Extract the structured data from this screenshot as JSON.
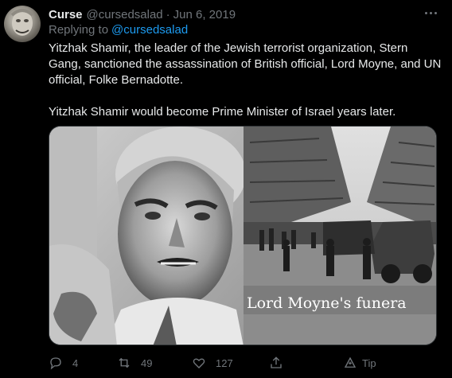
{
  "tweet": {
    "author_name": "Curse",
    "author_handle": "@cursedsalad",
    "separator": "·",
    "date": "Jun 6, 2019",
    "reply_prefix": "Replying to",
    "reply_mention": "@cursedsalad",
    "paragraphs": [
      "Yitzhak Shamir, the leader of the Jewish terrorist organization, Stern Gang, sanctioned the assassination of British official, Lord Moyne, and UN official, Folke Bernadotte.",
      "Yitzhak Shamir would become Prime Minister of Israel years later."
    ],
    "media": {
      "right_caption": "Lord Moyne's funera"
    },
    "actions": {
      "reply_count": "4",
      "retweet_count": "49",
      "like_count": "127",
      "tip_label": "Tip"
    }
  },
  "icons": {
    "more": "more-horizontal-icon",
    "reply": "speech-bubble-icon",
    "retweet": "retweet-arrows-icon",
    "like": "heart-icon",
    "share": "share-upload-icon",
    "tip": "tip-icon"
  },
  "colors": {
    "background": "#000000",
    "text_primary": "#e7e9ea",
    "text_secondary": "#71767b",
    "link": "#1d9bf0",
    "border": "#2f3336"
  }
}
